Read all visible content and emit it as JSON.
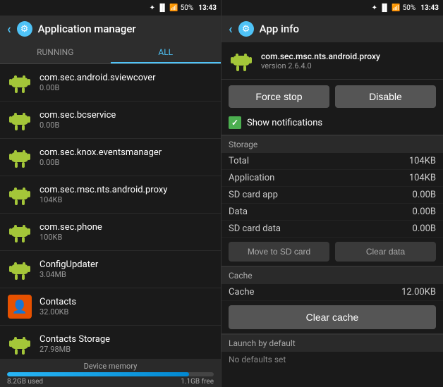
{
  "left": {
    "statusBar": {
      "bluetooth": "🎧",
      "signal": "📶",
      "battery": "50%",
      "time": "13:43"
    },
    "header": {
      "back": "‹",
      "title": "Application manager"
    },
    "tabs": [
      {
        "label": "RUNNING",
        "active": false
      },
      {
        "label": "ALL",
        "active": true
      }
    ],
    "apps": [
      {
        "name": "com.sec.android.sviewcover",
        "size": "0.00B",
        "iconType": "android"
      },
      {
        "name": "com.sec.bcservice",
        "size": "0.00B",
        "iconType": "android"
      },
      {
        "name": "com.sec.knox.eventsmanager",
        "size": "0.00B",
        "iconType": "android"
      },
      {
        "name": "com.sec.msc.nts.android.proxy",
        "size": "104KB",
        "iconType": "android"
      },
      {
        "name": "com.sec.phone",
        "size": "100KB",
        "iconType": "android"
      },
      {
        "name": "ConfigUpdater",
        "size": "3.04MB",
        "iconType": "android"
      },
      {
        "name": "Contacts",
        "size": "32.00KB",
        "iconType": "contact"
      },
      {
        "name": "Contacts Storage",
        "size": "27.98MB",
        "iconType": "android"
      }
    ],
    "memory": {
      "label": "Device memory",
      "used": "8.2GB used",
      "free": "1.1GB free",
      "fillPercent": 88
    }
  },
  "right": {
    "statusBar": {
      "battery": "50%",
      "time": "13:43"
    },
    "header": {
      "back": "‹",
      "title": "App info"
    },
    "app": {
      "package": "com.sec.msc.nts.android.proxy",
      "version": "version 2.6.4.0"
    },
    "buttons": {
      "forceStop": "Force stop",
      "disable": "Disable"
    },
    "showNotifications": "Show notifications",
    "storage": {
      "sectionLabel": "Storage",
      "rows": [
        {
          "label": "Total",
          "value": "104KB"
        },
        {
          "label": "Application",
          "value": "104KB"
        },
        {
          "label": "SD card app",
          "value": "0.00B"
        },
        {
          "label": "Data",
          "value": "0.00B"
        },
        {
          "label": "SD card data",
          "value": "0.00B"
        }
      ],
      "moveToSD": "Move to SD card",
      "clearData": "Clear data"
    },
    "cache": {
      "sectionLabel": "Cache",
      "cacheLabel": "Cache",
      "cacheValue": "12.00KB",
      "clearCache": "Clear cache"
    },
    "launchDefault": {
      "sectionLabel": "Launch by default",
      "description": "No defaults set"
    }
  }
}
